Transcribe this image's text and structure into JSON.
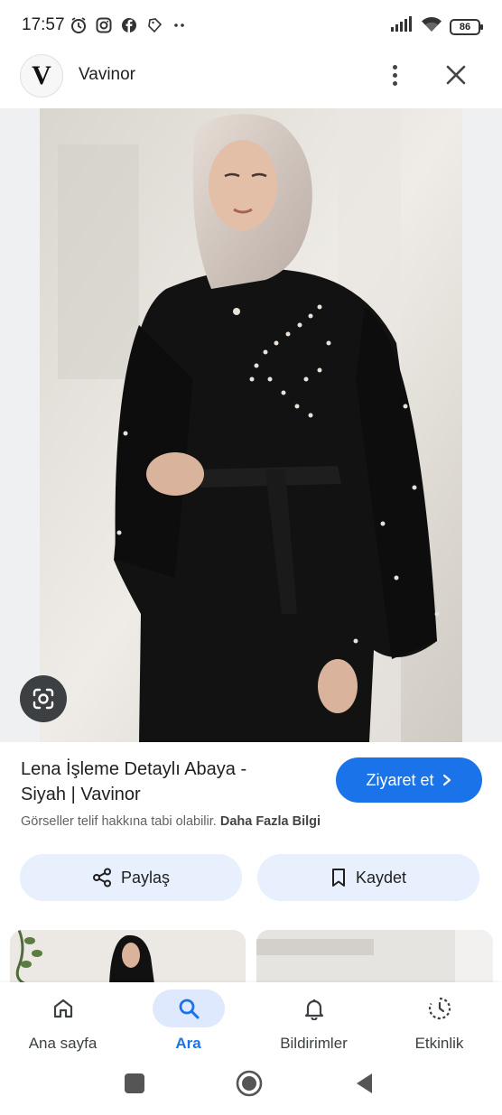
{
  "status_bar": {
    "time": "17:57",
    "battery": "86",
    "left_icons": [
      "alarm-icon",
      "instagram-icon",
      "facebook-icon",
      "tag-icon",
      "more-notifications-icon"
    ],
    "right_icons": [
      "signal-icon",
      "wifi-icon",
      "battery-icon"
    ]
  },
  "header": {
    "logo_letter": "V",
    "site_name": "Vavinor"
  },
  "result": {
    "title": "Lena İşleme Detaylı Abaya - Siyah | Vavinor",
    "visit_label": "Ziyaret et",
    "copyright_text": "Görseller telif hakkına tabi olabilir.",
    "more_info_link": "Daha Fazla Bilgi",
    "share_label": "Paylaş",
    "save_label": "Kaydet"
  },
  "colors": {
    "accent": "#1a73e8",
    "action_bg": "#e8f0fe",
    "nav_active_bg": "#dfe9fd"
  },
  "bottom_nav": {
    "items": [
      {
        "label": "Ana sayfa",
        "icon": "home-icon",
        "active": false
      },
      {
        "label": "Ara",
        "icon": "search-icon",
        "active": true
      },
      {
        "label": "Bildirimler",
        "icon": "bell-icon",
        "active": false
      },
      {
        "label": "Etkinlik",
        "icon": "activity-icon",
        "active": false
      }
    ]
  },
  "system_nav": [
    "recents-button",
    "home-button",
    "back-button"
  ]
}
